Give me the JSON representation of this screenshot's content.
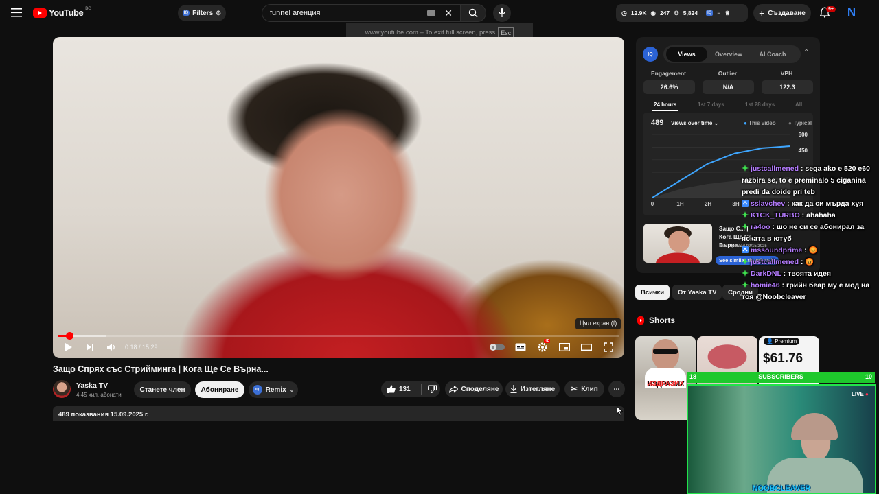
{
  "header": {
    "logo_text": "YouTube",
    "country": "BG",
    "filters_label": "Filters",
    "search_value": "funnel агенция",
    "fullscreen_tip": "www.youtube.com – To exit full screen, press",
    "fullscreen_key": "Esc",
    "stats": {
      "views": "12.9K",
      "likes": "247",
      "subs": "5,824"
    },
    "create_label": "Създаване",
    "notif_count": "9+",
    "avatar_letter": "N"
  },
  "player": {
    "time": "0:18 / 15:29",
    "fullscreen_tooltip": "Цял екран (f)",
    "progress": 0.019,
    "buffered": 0.085
  },
  "video": {
    "title": "Защо Спрях със Стрийминга | Кога Ще Се Върна...",
    "channel": "Yaska TV",
    "subscribers": "4,45 хил. абонати",
    "join_label": "Станете член",
    "subscribe_label": "Абониране",
    "remix_label": "Remix",
    "likes": "131",
    "share_label": "Споделяне",
    "download_label": "Изтегляне",
    "clip_label": "Клип",
    "description": "489 показвания  15.09.2025 г."
  },
  "analytics": {
    "tabs": [
      "Views",
      "Overview",
      "AI Coach"
    ],
    "metrics": [
      {
        "label": "Engagement",
        "value": "26.6%"
      },
      {
        "label": "Outlier",
        "value": "N/A"
      },
      {
        "label": "VPH",
        "value": "122.3"
      }
    ],
    "ranges": [
      "24 hours",
      "1st 7 days",
      "1st 28 days",
      "All"
    ],
    "views_count": "489",
    "views_dropdown": "Views over time",
    "legend_this": "This video",
    "legend_typical": "Typical",
    "related_title": "Защо С... | Кога Ще Се Върна...",
    "related_meta": "Last Updated 09/15/2025",
    "related_button": "See similar thumbnails"
  },
  "chart_data": {
    "type": "line",
    "x": [
      "0",
      "1H",
      "2H",
      "3H"
    ],
    "ylim": [
      0,
      600
    ],
    "ytick_labels": [
      "600",
      "450"
    ],
    "series": [
      {
        "name": "This video",
        "values": [
          0,
          160,
          320,
          420,
          470,
          489
        ]
      }
    ],
    "typical_band": [
      0,
      80,
      130,
      160,
      180,
      195
    ]
  },
  "chips": [
    "Всички",
    "От Yaska TV",
    "Сродни"
  ],
  "shorts": {
    "heading": "Shorts",
    "premium_badge": "Premium",
    "price_text": "$61.76",
    "overlay_text": "ИЗДРАЗИХ"
  },
  "chat": [
    {
      "user": "justcallmened",
      "text": "sega ako e 520 e60 razbira se, to e preminalo 5 ciganina predi da doide pri teb",
      "badge": "green"
    },
    {
      "user": "sslavchev",
      "text": "как да си мърда хуя",
      "badge": "blue"
    },
    {
      "user": "K1CK_TURBO",
      "text": "ahahaha",
      "badge": "green"
    },
    {
      "user": "ra4oo",
      "text": "шо не си се абонирал за яската в ютуб",
      "badge": "green"
    },
    {
      "user": "mssoundprime",
      "text": "😡",
      "badge": "blue"
    },
    {
      "user": "justcallmened",
      "text": "😡",
      "badge": "green"
    },
    {
      "user": "DarkDNL",
      "text": "твоята идея",
      "badge": "green"
    },
    {
      "user": "homie46",
      "text": "грийн беар му е мод на тоя @Noobcleaver",
      "badge": "green"
    }
  ],
  "stream": {
    "subs_left": "18",
    "subs_label": "SUBSCRIBERS",
    "subs_right": "10",
    "live_label": "LIVE",
    "streamer": "NOOBCLEAVER"
  },
  "colors": {
    "accent_red": "#ff0000",
    "chart_line": "#3ea6ff",
    "subs_green": "#1ec82c"
  }
}
